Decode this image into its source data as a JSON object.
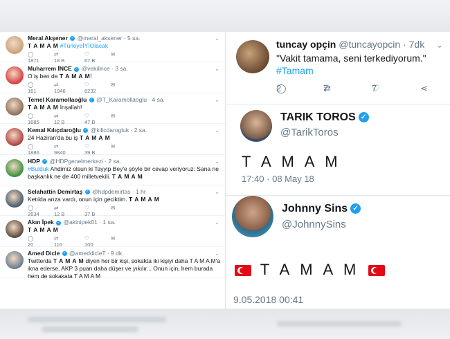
{
  "left_tweets": [
    {
      "name": "Meral Akşener",
      "handle": "@meral_aksener",
      "time": "· 5 sa.",
      "verified": true,
      "text": "T A M A M",
      "hashtag": " #TürkiyeİYİOlacak",
      "replies": "1871",
      "retweets": "18 B",
      "likes": "67 B",
      "avatar_color": "#c9a27a"
    },
    {
      "name": "Muharrem İNCE",
      "handle": "@vekilince",
      "time": "· 3 sa.",
      "verified": true,
      "text_prefix": "O iş ben de ",
      "text": "T A M A M",
      "text_suffix": "!",
      "replies": "161",
      "retweets": "1946",
      "likes": "8232",
      "avatar_color": "#d63b3b"
    },
    {
      "name": "Temel Karamollaoğlu",
      "handle": "@T_Karamollaoglu",
      "time": "· 4 sa.",
      "verified": true,
      "text": "T A M A M",
      "text_suffix": " İnşallah!",
      "replies": "1685",
      "retweets": "12 B",
      "likes": "47 B",
      "avatar_color": "#8b6d5a"
    },
    {
      "name": "Kemal Kılıçdaroğlu",
      "handle": "@kilicdarogluk",
      "time": "· 2 sa.",
      "verified": true,
      "text_prefix": "24 Haziran'da bu iş ",
      "text": "T A M A M",
      "replies": "1886",
      "retweets": "9840",
      "likes": "39 B",
      "avatar_color": "#b04040"
    },
    {
      "name": "HDP",
      "handle": "@HDPgenelmerkezi",
      "time": "· 2 sa.",
      "verified": true,
      "hashtag_prefix": "#Bulduk",
      "text_prefix": " Ahdimiz olsun ki Tayyip Bey'e şöyle bir cevap veriyoruz: Sana ne başkanlık ne de 400 milletvekili. ",
      "text": "T A M A M",
      "avatar_color": "#3a8f3a"
    },
    {
      "name": "Selahattin Demirtaş",
      "handle": "@hdpdemirtas",
      "time": "· 1 hr",
      "verified": true,
      "text_prefix": "Ketılda arıza vardı, onun için geciktim. ",
      "text": "T A M A M",
      "replies": "2634",
      "retweets": "12 B",
      "likes": "37 B",
      "avatar_color": "#4a5a6a"
    },
    {
      "name": "Akın İpek",
      "handle": "@akinipek01",
      "time": "· 1 sa.",
      "verified": true,
      "text": "T A M A M",
      "replies": "20",
      "retweets": "116",
      "likes": "100",
      "avatar_color": "#5a4a3e"
    },
    {
      "name": "Amed Dicle",
      "handle": "@ameddicleT",
      "time": "· 9 dk.",
      "verified": true,
      "text_prefix": "Twitterda ",
      "text": "T A M A M",
      "text_suffix": " diyen her bir kişi, sokakta iki kişiyi daha T A M A M'a ikna ederse, AKP 3 puan daha düşer ve yıkılır... Onun için, hem burada hem de sokakata T A M A M",
      "avatar_color": "#6b7b8b"
    }
  ],
  "right": {
    "t1": {
      "name": "tuncay opçin",
      "handle": "@tuncayopcin",
      "time": "· 7dk",
      "text": "\"Vakit tamama, seni terkediyorum.\"",
      "hashtag": "#Tamam",
      "replies": "2",
      "retweets": "7",
      "likes": "7"
    },
    "t2": {
      "name": "TARIK TOROS",
      "handle": "@TarikToros",
      "text": "T A M A M",
      "timestamp": "17:40 · 08 May 18"
    },
    "t3": {
      "name": "Johnny Sins",
      "handle": "@JohnnySins",
      "text": "T A M A M",
      "timestamp": "9.05.2018 00:41"
    }
  },
  "icons": {
    "reply": "reply-icon",
    "retweet": "retweet-icon",
    "like": "heart-icon",
    "dm": "mail-icon",
    "share": "share-icon",
    "verified": "verified-badge-icon",
    "chevron": "chevron-down-icon"
  },
  "colors": {
    "twitter_blue": "#1da1f2",
    "gray_text": "#657786",
    "flag_red": "#e30a17"
  }
}
